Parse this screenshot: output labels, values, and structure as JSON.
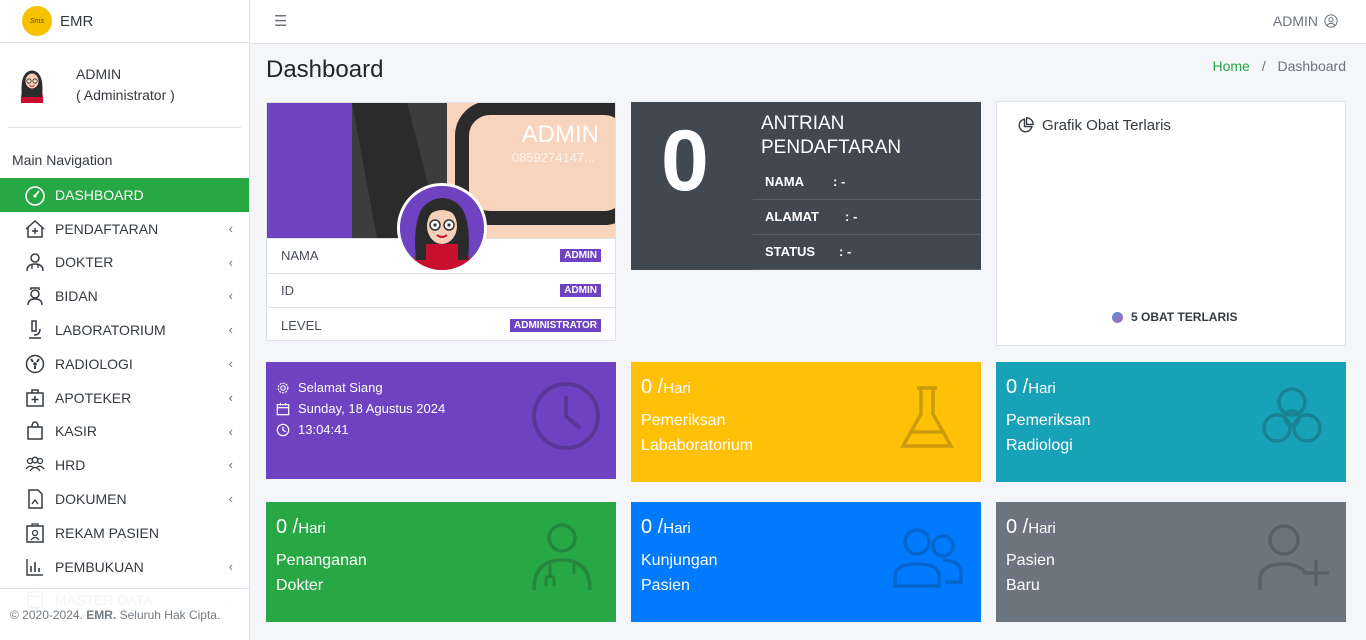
{
  "brand": {
    "logo_text": "Sms",
    "name": "EMR"
  },
  "user": {
    "name": "ADMIN",
    "role": "( Administrator )"
  },
  "nav": {
    "header": "Main Navigation",
    "items": [
      {
        "label": "DASHBOARD",
        "icon": "dashboard-icon",
        "active": true,
        "chev": false
      },
      {
        "label": "PENDAFTARAN",
        "icon": "house-plus-icon",
        "chev": true
      },
      {
        "label": "DOKTER",
        "icon": "doctor-icon",
        "chev": true
      },
      {
        "label": "BIDAN",
        "icon": "nurse-icon",
        "chev": true
      },
      {
        "label": "LABORATORIUM",
        "icon": "microscope-icon",
        "chev": true
      },
      {
        "label": "RADIOLOGI",
        "icon": "radiology-icon",
        "chev": true
      },
      {
        "label": "APOTEKER",
        "icon": "medkit-icon",
        "chev": true
      },
      {
        "label": "KASIR",
        "icon": "bag-icon",
        "chev": true
      },
      {
        "label": "HRD",
        "icon": "people-icon",
        "chev": true
      },
      {
        "label": "DOKUMEN",
        "icon": "document-icon",
        "chev": true
      },
      {
        "label": "REKAM PASIEN",
        "icon": "record-icon",
        "chev": false
      },
      {
        "label": "PEMBUKUAN",
        "icon": "bar-chart-icon",
        "chev": true
      },
      {
        "label": "MASTER DATA",
        "icon": "database-icon",
        "chev": true
      }
    ]
  },
  "footer": {
    "copy": "© 2020-2024.",
    "brand": "EMR.",
    "rest": "Seluruh Hak Cipta."
  },
  "topbar": {
    "user": "ADMIN"
  },
  "page": {
    "title": "Dashboard",
    "crumb_home": "Home",
    "crumb_sep": "/",
    "crumb_current": "Dashboard"
  },
  "profile": {
    "name": "ADMIN",
    "phone": "0859274147...",
    "rows": [
      {
        "label": "NAMA",
        "value": "ADMIN"
      },
      {
        "label": "ID",
        "value": "ADMIN"
      },
      {
        "label": "LEVEL",
        "value": "ADMINISTRATOR"
      }
    ]
  },
  "antrian": {
    "count": "0",
    "title1": "ANTRIAN",
    "title2": "PENDAFTARAN",
    "rows": [
      {
        "label": "NAMA",
        "value": ": -"
      },
      {
        "label": "ALAMAT",
        "value": ": -"
      },
      {
        "label": "STATUS",
        "value": ": -"
      }
    ]
  },
  "grafik": {
    "title": "Grafik Obat Terlaris",
    "legend": "5 OBAT TERLARIS"
  },
  "greeting": {
    "salam": "Selamat Siang",
    "date": "Sunday, 18 Agustus 2024",
    "time": "13:04:41"
  },
  "boxes": [
    {
      "num": "0 /",
      "unit": "Hari",
      "line1": "Pemeriksan",
      "line2": "Lababoratorium",
      "color": "#ffc107",
      "icon": "flask-icon"
    },
    {
      "num": "0 /",
      "unit": "Hari",
      "line1": "Pemeriksan",
      "line2": "Radiologi",
      "color": "#17a2b8",
      "icon": "biohazard-icon"
    },
    {
      "num": "0 /",
      "unit": "Hari",
      "line1": "Penanganan",
      "line2": "Dokter",
      "color": "#28a745",
      "icon": "doctor-icon"
    },
    {
      "num": "0 /",
      "unit": "Hari",
      "line1": "Kunjungan",
      "line2": "Pasien",
      "color": "#007bff",
      "icon": "people-icon"
    },
    {
      "num": "0 /",
      "unit": "Hari",
      "line1": "Pasien",
      "line2": "Baru",
      "color": "#6c757d",
      "icon": "user-plus-icon"
    }
  ]
}
